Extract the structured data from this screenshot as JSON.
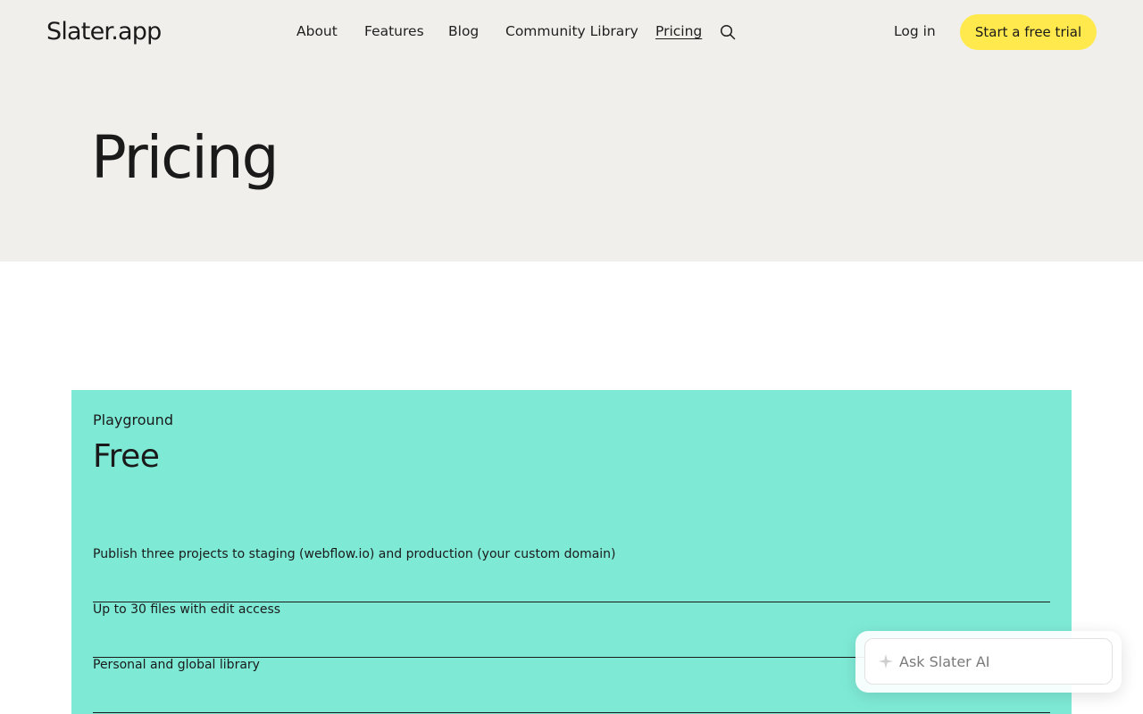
{
  "header": {
    "logo": "Slater.app",
    "nav": [
      {
        "label": "About"
      },
      {
        "label": "Features"
      },
      {
        "label": "Blog"
      },
      {
        "label": "Community Library"
      },
      {
        "label": "Pricing"
      }
    ],
    "login": "Log in",
    "cta": "Start a free trial",
    "icons": {
      "search": "search-icon"
    }
  },
  "hero": {
    "title": "Pricing"
  },
  "plan": {
    "name": "Playground",
    "price": "Free",
    "features": [
      "Publish three projects to staging (webflow.io) and production (your custom domain)",
      "Up to 30 files with edit access",
      "Personal and global library"
    ]
  },
  "ai": {
    "placeholder": "Ask Slater AI",
    "icon": "sparkle-icon"
  },
  "colors": {
    "nav_bg": "#f0efeb",
    "cta_bg": "#ffe94d",
    "plan_bg": "#7eead6"
  }
}
